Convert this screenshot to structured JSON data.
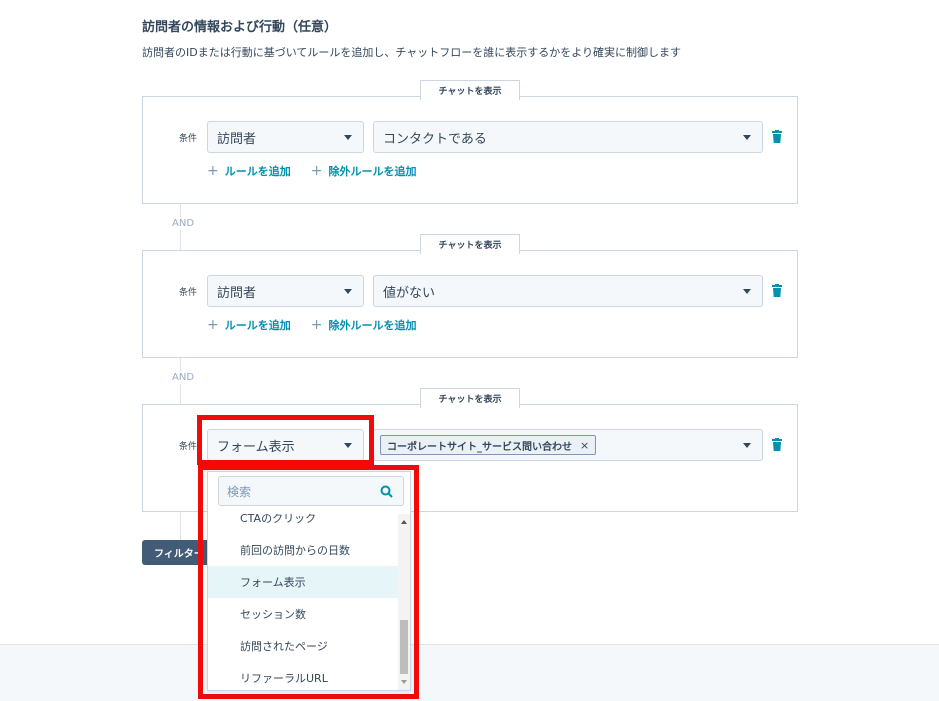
{
  "section": {
    "title": "訪問者の情報および行動（任意）",
    "description": "訪問者のIDまたは行動に基づいてルールを追加し、チャットフローを誰に表示するかをより確実に制御します"
  },
  "groups": [
    {
      "tab": "チャットを表示",
      "condition_label": "条件",
      "field_select": "訪問者",
      "value_select": "コンタクトである",
      "add_rule": "ルールを追加",
      "add_exclude_rule": "除外ルールを追加"
    },
    {
      "tab": "チャットを表示",
      "condition_label": "条件",
      "field_select": "訪問者",
      "value_select": "値がない",
      "add_rule": "ルールを追加",
      "add_exclude_rule": "除外ルールを追加"
    },
    {
      "tab": "チャットを表示",
      "condition_label": "条件",
      "field_select": "フォーム表示",
      "value_tag": "コーポレートサイト_サービス問い合わせ",
      "tag_remove": "×"
    }
  ],
  "and_label": "AND",
  "filter_button": "フィルター",
  "dropdown": {
    "search_placeholder": "検索",
    "items": [
      {
        "label": "CTAのクリック",
        "active": false
      },
      {
        "label": "前回の訪問からの日数",
        "active": false
      },
      {
        "label": "フォーム表示",
        "active": true
      },
      {
        "label": "セッション数",
        "active": false
      },
      {
        "label": "訪問されたページ",
        "active": false
      },
      {
        "label": "リファーラルURL",
        "active": false
      }
    ]
  },
  "colors": {
    "accent_link": "#0091ae",
    "highlight_border": "#f00a0a",
    "button_bg": "#425b76"
  }
}
